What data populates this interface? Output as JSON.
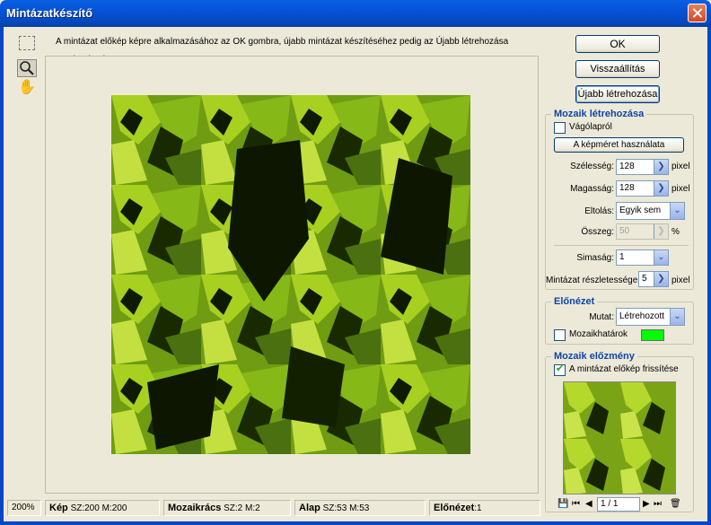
{
  "window": {
    "title": "Mintázatkészítő"
  },
  "instructions": "A mintázat előkép képre alkalmazásához az OK gombra, újabb mintázat készítéséhez pedig az Újabb létrehozása gombra kattintson.",
  "buttons": {
    "ok": "OK",
    "reset": "Visszaállítás",
    "new": "Újabb létrehozása"
  },
  "tile_group": {
    "legend": "Mozaik létrehozása",
    "clipboard_label": "Vágólapról",
    "clipboard_checked": false,
    "use_image_size": "A képméret használata",
    "width_label": "Szélesség:",
    "width_value": "128",
    "height_label": "Magasság:",
    "height_value": "128",
    "unit": "pixel",
    "offset_label": "Eltolás:",
    "offset_value": "Egyik sem",
    "amount_label": "Összeg:",
    "amount_value": "50",
    "amount_unit": "%",
    "smoothness_label": "Simaság:",
    "smoothness_value": "1",
    "detail_label": "Mintázat részletessége:",
    "detail_value": "5",
    "detail_unit": "pixel"
  },
  "preview_group": {
    "legend": "Előnézet",
    "show_label": "Mutat:",
    "show_value": "Létrehozott",
    "tile_boundaries_label": "Mozaikhatárok",
    "tile_boundaries_checked": false,
    "boundary_color": "#00ff00"
  },
  "history_group": {
    "legend": "Mozaik előzmény",
    "update_preview_label": "A mintázat előkép frissítése",
    "update_preview_checked": true,
    "page_value": "1 / 1"
  },
  "status": {
    "zoom": "200%",
    "image_label": "Kép",
    "image_value": "SZ:200 M:200",
    "grid_label": "Mozaikrács",
    "grid_value": "SZ:2 M:2",
    "base_label": "Alap",
    "base_value": "SZ:53 M:53",
    "preview_label": "Előnézet",
    "preview_value": ":1"
  },
  "colors": {
    "accent": "#0c46a8",
    "titlebar": "#0552d8",
    "foliage_light": "#a8d020",
    "foliage_dark": "#1a2a00"
  }
}
